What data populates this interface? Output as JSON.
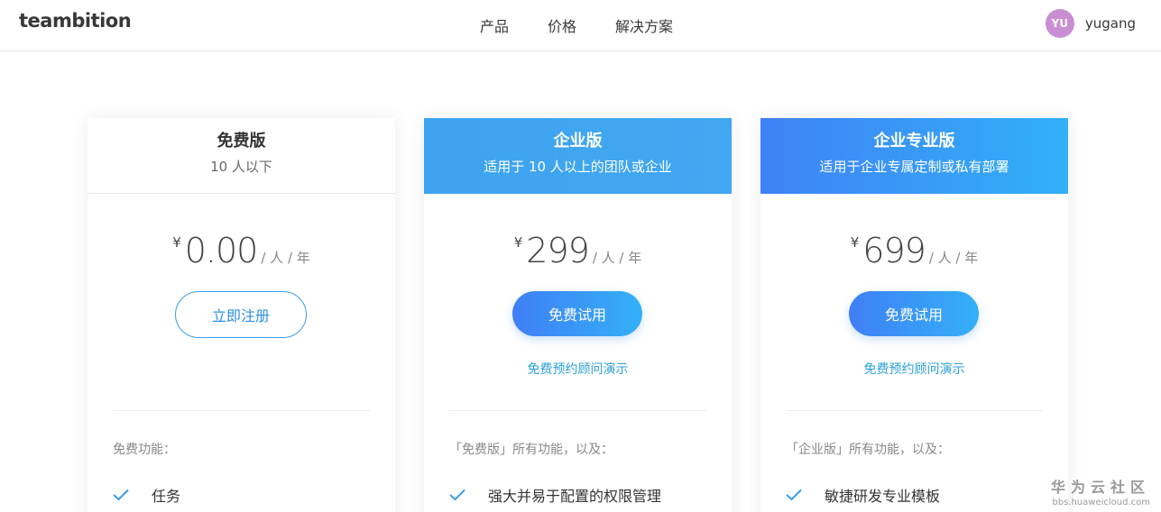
{
  "header": {
    "logo": "teambition",
    "nav": [
      "产品",
      "价格",
      "解决方案"
    ],
    "user": {
      "avatar_initials": "YU",
      "name": "yugang",
      "avatar_color": "#c98ed2"
    }
  },
  "plans": [
    {
      "name": "免费版",
      "subtitle": "10 人以下",
      "currency": "¥",
      "price": "0.00",
      "unit": "/ 人 / 年",
      "button": "立即注册",
      "features_title": "免费功能：",
      "features": [
        "任务"
      ]
    },
    {
      "name": "企业版",
      "subtitle": "适用于 10 人以上的团队或企业",
      "currency": "¥",
      "price": "299",
      "unit": "/ 人 / 年",
      "button": "免费试用",
      "demo_link": "免费预约顾问演示",
      "features_title": "「免费版」所有功能，以及：",
      "features": [
        "强大并易于配置的权限管理"
      ]
    },
    {
      "name": "企业专业版",
      "subtitle": "适用于企业专属定制或私有部署",
      "currency": "¥",
      "price": "699",
      "unit": "/ 人 / 年",
      "button": "免费试用",
      "demo_link": "免费预约顾问演示",
      "features_title": "「企业版」所有功能，以及：",
      "features": [
        "敏捷研发专业模板"
      ]
    }
  ],
  "watermark": {
    "title": "华为云社区",
    "url": "bbs.huaweicloud.com"
  },
  "colors": {
    "accent": "#2d8fe3",
    "check": "#3a9de8",
    "link": "#2aa0d8"
  }
}
